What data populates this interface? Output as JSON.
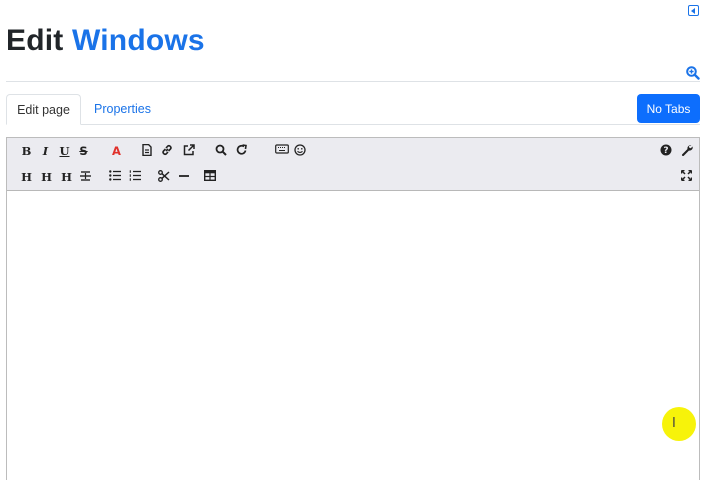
{
  "page": {
    "title_prefix": "Edit",
    "title_name": "Windows"
  },
  "tabs": [
    {
      "label": "Edit page",
      "active": true
    },
    {
      "label": "Properties",
      "active": false
    }
  ],
  "actions": {
    "no_tabs_label": "No Tabs"
  },
  "toolbar": {
    "row1": {
      "bold": "B",
      "italic": "I",
      "underline": "U",
      "strikethrough": "S",
      "font_color": "A",
      "icons": [
        "bold-icon",
        "italic-icon",
        "underline-icon",
        "strikethrough-icon",
        "font-color-icon",
        "file-icon",
        "link-icon",
        "external-link-icon",
        "search-icon",
        "redo-icon",
        "keyboard-icon",
        "smiley-icon",
        "help-icon",
        "wrench-icon"
      ]
    },
    "row2": {
      "h1": "H",
      "h2": "H",
      "h3": "H",
      "icons": [
        "heading1-icon",
        "heading2-icon",
        "heading3-icon",
        "align-center-icon",
        "bullet-list-icon",
        "numbered-list-icon",
        "cut-icon",
        "horizontal-rule-icon",
        "table-icon",
        "fullscreen-icon"
      ]
    }
  },
  "colors": {
    "accent": "#1a73e8",
    "primary_button": "#0d6efd",
    "toolbar_bg": "#ebebf0",
    "font_color_red": "#e0312b",
    "cursor_highlight": "#f7f30a"
  }
}
